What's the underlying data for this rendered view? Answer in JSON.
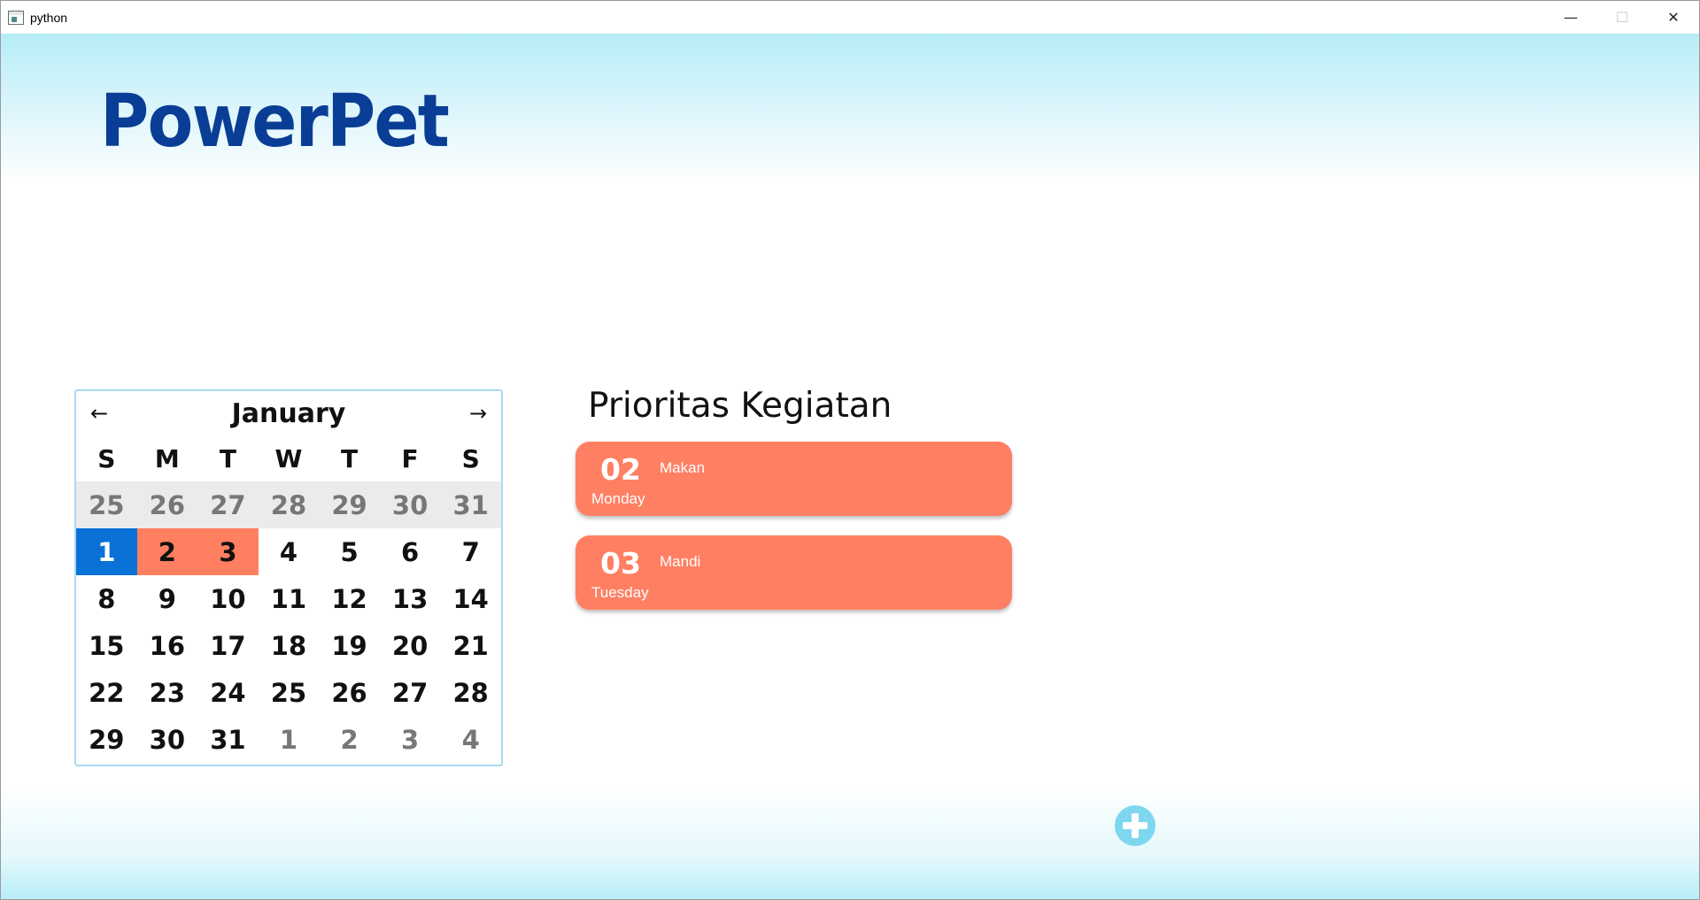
{
  "window": {
    "title": "python",
    "controls": {
      "minimize": "—",
      "maximize": "☐",
      "close": "✕"
    }
  },
  "app": {
    "logo": "PowerPet"
  },
  "calendar": {
    "month": "January",
    "prev_icon": "←",
    "next_icon": "→",
    "weekdays": [
      "S",
      "M",
      "T",
      "W",
      "T",
      "F",
      "S"
    ],
    "weeks": [
      [
        "25",
        "26",
        "27",
        "28",
        "29",
        "30",
        "31"
      ],
      [
        "1",
        "2",
        "3",
        "4",
        "5",
        "6",
        "7"
      ],
      [
        "8",
        "9",
        "10",
        "11",
        "12",
        "13",
        "14"
      ],
      [
        "15",
        "16",
        "17",
        "18",
        "19",
        "20",
        "21"
      ],
      [
        "22",
        "23",
        "24",
        "25",
        "26",
        "27",
        "28"
      ],
      [
        "29",
        "30",
        "31",
        "1",
        "2",
        "3",
        "4"
      ]
    ],
    "selected_day": "1",
    "event_days": [
      "2",
      "3"
    ],
    "colors": {
      "selected": "#0a72d6",
      "event": "#ff7f60",
      "prev_month_row": "#ebebeb"
    }
  },
  "priorities": {
    "title": "Prioritas Kegiatan",
    "items": [
      {
        "day": "02",
        "weekday": "Monday",
        "activity": "Makan"
      },
      {
        "day": "03",
        "weekday": "Tuesday",
        "activity": "Mandi"
      }
    ],
    "card_color": "#ff7f63"
  },
  "add_button": {
    "icon": "plus-icon",
    "color": "#7fd7ef"
  }
}
